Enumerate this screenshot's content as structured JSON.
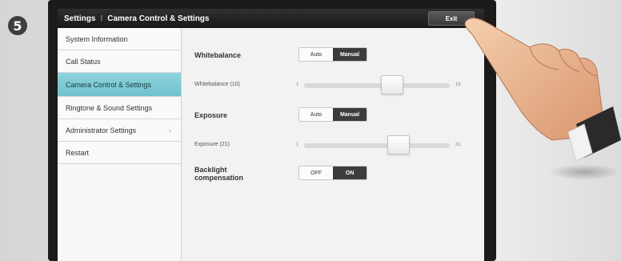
{
  "step": {
    "number": "5"
  },
  "titlebar": {
    "section": "Settings",
    "separator": "I",
    "page": "Camera Control & Settings",
    "exit_label": "Exit"
  },
  "sidebar": {
    "items": [
      {
        "label": "System Information",
        "active": false,
        "has_chevron": false
      },
      {
        "label": "Call Status",
        "active": false,
        "has_chevron": false
      },
      {
        "label": "Camera Control & Settings",
        "active": true,
        "has_chevron": false
      },
      {
        "label": "Ringtone & Sound Settings",
        "active": false,
        "has_chevron": false
      },
      {
        "label": "Administrator Settings",
        "active": false,
        "has_chevron": true
      },
      {
        "label": "Restart",
        "active": false,
        "has_chevron": false
      }
    ]
  },
  "whitebalance": {
    "label": "Whitebalance",
    "mode_auto": "Auto",
    "mode_manual": "Manual",
    "selected": "Manual",
    "slider_label": "Whitebalance (10)",
    "min": "1",
    "max": "16",
    "value": 10
  },
  "exposure": {
    "label": "Exposure",
    "mode_auto": "Auto",
    "mode_manual": "Manual",
    "selected": "Manual",
    "slider_label": "Exposure (21)",
    "min": "1",
    "max": "31",
    "value": 21
  },
  "backlight": {
    "label_line1": "Backlight",
    "label_line2": "compensation",
    "off_label": "OFF",
    "on_label": "ON",
    "selected": "ON"
  },
  "colors": {
    "active_item": "#7fcbd6",
    "titlebar": "#1e1e1e",
    "selected_segment": "#3c3c3c"
  },
  "icons": {
    "step_badge": "circled-number-icon",
    "pointer": "pointing-hand-icon",
    "chevron": "chevron-right-icon"
  }
}
